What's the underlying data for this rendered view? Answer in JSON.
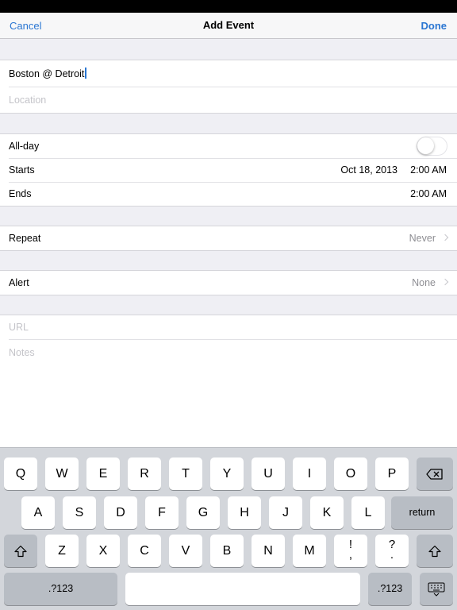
{
  "nav": {
    "cancel": "Cancel",
    "title": "Add Event",
    "done": "Done"
  },
  "event": {
    "title_value": "Boston @ Detroit",
    "location_placeholder": "Location"
  },
  "schedule": {
    "allday_label": "All-day",
    "allday_on": false,
    "starts_label": "Starts",
    "starts_date": "Oct 18, 2013",
    "starts_time": "2:00 AM",
    "ends_label": "Ends",
    "ends_time": "2:00 AM"
  },
  "repeat": {
    "label": "Repeat",
    "value": "Never"
  },
  "alert": {
    "label": "Alert",
    "value": "None"
  },
  "extra": {
    "url_placeholder": "URL",
    "notes_placeholder": "Notes"
  },
  "keyboard": {
    "row1": [
      "Q",
      "W",
      "E",
      "R",
      "T",
      "Y",
      "U",
      "I",
      "O",
      "P"
    ],
    "row2": [
      "A",
      "S",
      "D",
      "F",
      "G",
      "H",
      "J",
      "K",
      "L"
    ],
    "return_label": "return",
    "row3": [
      "Z",
      "X",
      "C",
      "V",
      "B",
      "N",
      "M"
    ],
    "punct1_top": "!",
    "punct1_bottom": ",",
    "punct2_top": "?",
    "punct2_bottom": ".",
    "numbers_label": ".?123",
    "icons": {
      "backspace": "backspace-icon",
      "shift": "shift-icon",
      "hide_keyboard": "keyboard-hide-icon"
    }
  },
  "colors": {
    "accent": "#2a76d2",
    "background": "#efeff4",
    "keyboard": "#d3d6db"
  }
}
